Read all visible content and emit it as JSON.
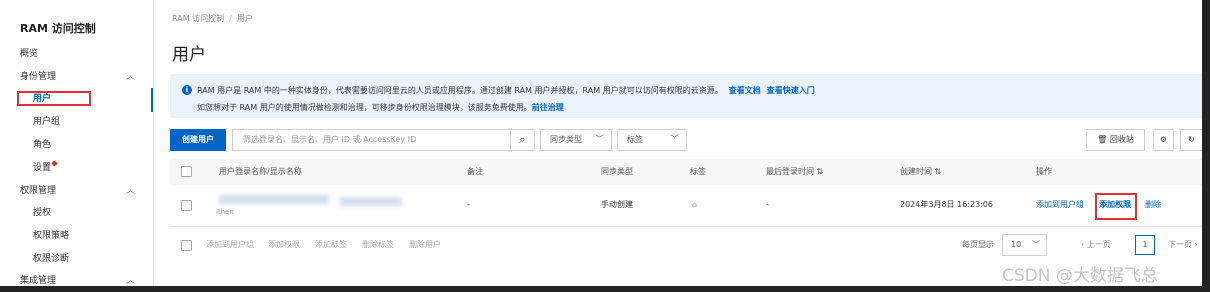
{
  "sidebar": {
    "brand": "RAM 访问控制",
    "items": [
      {
        "label": "概览"
      },
      {
        "label": "身份管理"
      },
      {
        "label": "用户"
      },
      {
        "label": "用户组"
      },
      {
        "label": "角色"
      },
      {
        "label": "设置"
      },
      {
        "label": "权限管理"
      },
      {
        "label": "授权"
      },
      {
        "label": "权限策略"
      },
      {
        "label": "权限诊断"
      },
      {
        "label": "集成管理"
      }
    ]
  },
  "breadcrumb": {
    "root": "RAM 访问控制",
    "sep": "/",
    "current": "用户"
  },
  "page_title": "用户",
  "notice": {
    "line1": "RAM 用户是 RAM 中的一种实体身份，代表需要访问阿里云的人员或应用程序。通过创建 RAM 用户并授权，RAM 用户就可以访问有权限的云资源。",
    "link_docs": "查看文档",
    "link_quickstart": "查看快速入门",
    "line2": "如您想对于 RAM 用户的使用情况做检测和治理，可移步身份权限治理模块，该服务免费使用。",
    "link_govern": "前往治理"
  },
  "toolbar": {
    "create_user": "创建用户",
    "search_placeholder": "筛选登录名、显示名、用户 ID 或 AccessKey ID",
    "sync_type": "同步类型",
    "tags": "标签",
    "recycle_bin": "回收站"
  },
  "table": {
    "columns": [
      "用户登录名称/显示名称",
      "备注",
      "同步类型",
      "标签",
      "最后登录时间",
      "创建时间",
      "操作"
    ],
    "rows": [
      {
        "name_partial": "ithen",
        "remark": "-",
        "sync_type": "手动创建",
        "last_login": "-",
        "created": "2024年3月8日 16:23:06",
        "actions": [
          "添加到用户组",
          "添加权限",
          "删除"
        ]
      }
    ]
  },
  "batch_actions": [
    "添加到用户组",
    "添加权限",
    "添加标签",
    "删除标签",
    "删除用户"
  ],
  "pagination": {
    "per_page_label": "每页显示",
    "per_page": "10",
    "prev": "上一页",
    "current": "1",
    "next": "下一页"
  },
  "watermark": "CSDN @大数据飞总"
}
